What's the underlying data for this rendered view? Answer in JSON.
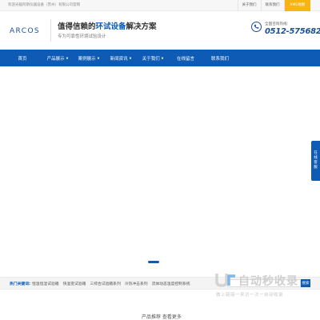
{
  "topbar": {
    "welcome": "欢迎光临阿斯仪器设备（苏州）有限公司官网",
    "links": [
      "关于我们",
      "联系我们",
      "XML地图"
    ]
  },
  "header": {
    "logo": "ARCOS",
    "slogan_prefix": "值得信赖的",
    "slogan_highlight": "环试设备",
    "slogan_suffix": "解决方案",
    "subslogan": "专为可靠性环境试验设计",
    "hotline_label": "全国咨询热线：",
    "hotline_number": "0512-57568285"
  },
  "nav": {
    "items": [
      {
        "label": "首页",
        "dropdown": false
      },
      {
        "label": "产品展示",
        "dropdown": true
      },
      {
        "label": "案例展示",
        "dropdown": true
      },
      {
        "label": "新闻资讯",
        "dropdown": true
      },
      {
        "label": "关于我们",
        "dropdown": true
      },
      {
        "label": "在线留言",
        "dropdown": false
      },
      {
        "label": "联系我们",
        "dropdown": false
      }
    ]
  },
  "float_panel": {
    "chars": [
      "在",
      "线",
      "客",
      "服"
    ]
  },
  "keywords": {
    "label": "热门关键词:",
    "items": [
      "恒温恒湿试验箱",
      "快温变试验箱",
      "三综合试验箱系列",
      "冷热冲击系列",
      "流体动态温度控制系统"
    ]
  },
  "search": {
    "button_label": "搜索"
  },
  "watermark": {
    "title": "自动秒收录",
    "sub": "做上链接一来访一次一自动收录"
  },
  "section": {
    "heading": "产品推荐  查看更多"
  },
  "colors": {
    "brand_blue": "#0d5bb5",
    "accent_yellow": "#f7b514"
  }
}
